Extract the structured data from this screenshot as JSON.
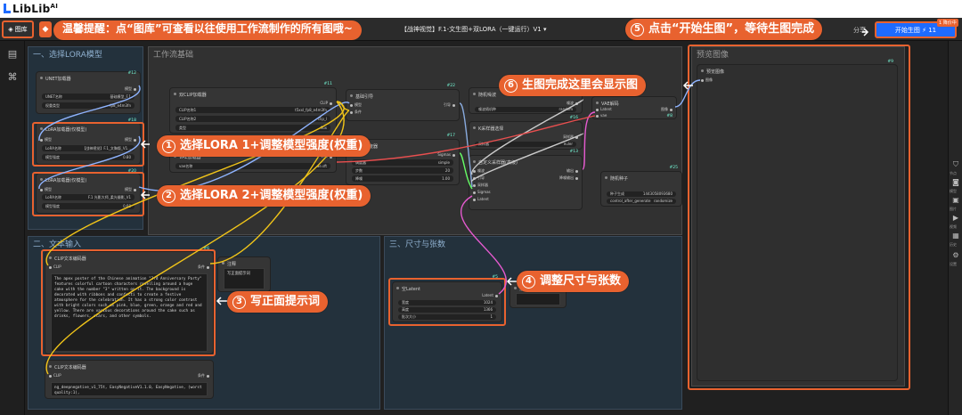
{
  "brand": {
    "logo_text": "LibLib",
    "logo_sup": "AI"
  },
  "toolbar": {
    "gallery_label": "图库",
    "workflow_title": "【战神视觉】F.1-文生图+双LORA（一键运行）V1",
    "share_label": "分享",
    "run_label": "开始生图",
    "run_cost": "⚡ 11",
    "run_badge": "1 降价中"
  },
  "tip_banner": "温馨提醒：点“图库”可查看以往使用工作流制作的所有图哦~",
  "groups": {
    "lora": "一、选择LORA模型",
    "base": "工作流基础",
    "text": "二、文本输入",
    "size": "三、尺寸与张数",
    "preview": "预览图像"
  },
  "nodes": {
    "unet": {
      "title": "UNET加载器",
      "id": "#12",
      "port_out": "模型",
      "unet_name_label": "UNET名称",
      "unet_name_value": "基础模型_F.1",
      "dtype_label": "权重类型",
      "dtype_value": "fp8_e4m3fn"
    },
    "lora1": {
      "title": "LoRA加载器(仅模型)",
      "id": "#18",
      "port_in": "模型",
      "port_out": "模型",
      "name_label": "LoRA名称",
      "name_value": "【战神视觉】F.1_文胸版_V1...",
      "strength_label": "模型强度",
      "strength_value": "0.80"
    },
    "lora2": {
      "title": "LoRA加载器(仅模型)",
      "id": "#20",
      "port_in": "模型",
      "port_out": "模型",
      "name_label": "LoRA名称",
      "name_value": "F.1 光影大师_柔光摄影_V1",
      "strength_label": "模型强度",
      "strength_value": "0.60"
    },
    "dual_clip": {
      "title": "双CLIP加载器",
      "id": "#11",
      "port_out": "CLIP",
      "clip1_label": "CLIP名称1",
      "clip1_value": "t5xxl_fp8_e4m3fn",
      "clip2_label": "CLIP名称2",
      "clip2_value": "clip_l",
      "type_label": "类型",
      "type_value": "flux"
    },
    "vae_loader": {
      "title": "VAE加载器",
      "id": "#10",
      "port_out": "VAE",
      "name_label": "vae名称",
      "name_value": "ae.sft"
    },
    "guider": {
      "title": "基础引导",
      "id": "#22",
      "in1": "模型",
      "in2": "条件",
      "port_out": "引导"
    },
    "scheduler": {
      "title": "基础调度器",
      "id": "#17",
      "in1": "模型",
      "port_out": "Sigmas",
      "sched_label": "调度器",
      "sched_value": "simple",
      "steps_label": "步数",
      "steps_value": "20",
      "denoise_label": "降噪",
      "denoise_value": "1.00"
    },
    "noise": {
      "title": "随机噪波",
      "id": "#25",
      "port_out": "噪波",
      "seed_label": "噪波随机种",
      "seed_value": "random"
    },
    "sampler_select": {
      "title": "K采样器选择",
      "id": "#16",
      "port_out": "采样器",
      "name_label": "采样器",
      "name_value": "euler"
    },
    "custom_sampler": {
      "title": "自定义采样器(高级)",
      "id": "#13",
      "in_noise": "噪波",
      "in_guider": "引导",
      "in_sampler": "采样器",
      "in_sigmas": "Sigmas",
      "in_latent": "Latent",
      "out1": "输出",
      "out2": "降噪输出"
    },
    "vae_decode": {
      "title": "VAE解码",
      "id": "#8",
      "in1": "Latent",
      "in2": "vae",
      "port_out": "图像"
    },
    "seed_gen": {
      "title": "随机种子",
      "id": "#25",
      "label1": "种子生成",
      "value1": "1443058093680",
      "label2": "control_after_generate",
      "value2": "randomize"
    },
    "clip_encode": {
      "title": "CLIP文本编码器",
      "id": "#6",
      "port_in": "CLIP",
      "port_out": "条件",
      "text": "The apex poster of the Chinese animation \"3rd Anniversary Party\" features colorful cartoon characters revelling around a huge cake with the number \"3\" written on it. The background is decorated with ribbons and confetti to create a festive atmosphere for the celebration. It has a strong color contrast with bright colors such as pink, blue, green, orange and red and yellow. There are various decorations around the cake such as drinks, flowers, stars, and other symbols."
    },
    "note": {
      "title": "注释",
      "text": "写正面提示词"
    },
    "clip_encode2": {
      "title": "CLIP文本编码器",
      "port_in": "CLIP",
      "port_out": "条件",
      "text": "ng_deepnegative_v1_75t, EasyNegativeV1.1.0, EasyNegative, (worst quality:1),"
    },
    "empty_latent": {
      "title": "空Latent",
      "id": "#5",
      "port_out": "Latent",
      "w_label": "宽度",
      "w_value": "1024",
      "h_label": "高度",
      "h_value": "1366",
      "b_label": "批次大小",
      "b_value": "1"
    },
    "note2": {
      "title": "注释",
      "text": ""
    },
    "preview": {
      "title": "预览图像",
      "id": "#9",
      "port_in": "图像"
    }
  },
  "callouts": {
    "c1": {
      "num": "1",
      "text": "选择LORA 1+调整模型强度(权重)"
    },
    "c2": {
      "num": "2",
      "text": "选择LORA 2+调整模型强度(权重)"
    },
    "c3": {
      "num": "3",
      "text": "写正面提示词"
    },
    "c4": {
      "num": "4",
      "text": "调整尺寸与张数"
    },
    "c5": {
      "num": "5",
      "text": "点击“开始生图”，等待生图完成"
    },
    "c6": {
      "num": "6",
      "text": "生图完成这里会显示图"
    }
  },
  "right_sidebar": [
    "节点",
    "模型",
    "图片",
    "视频",
    "历史",
    "设置"
  ],
  "colors": {
    "accent": "#e8622f",
    "primary": "#1e6bff",
    "canvas": "#202020"
  }
}
